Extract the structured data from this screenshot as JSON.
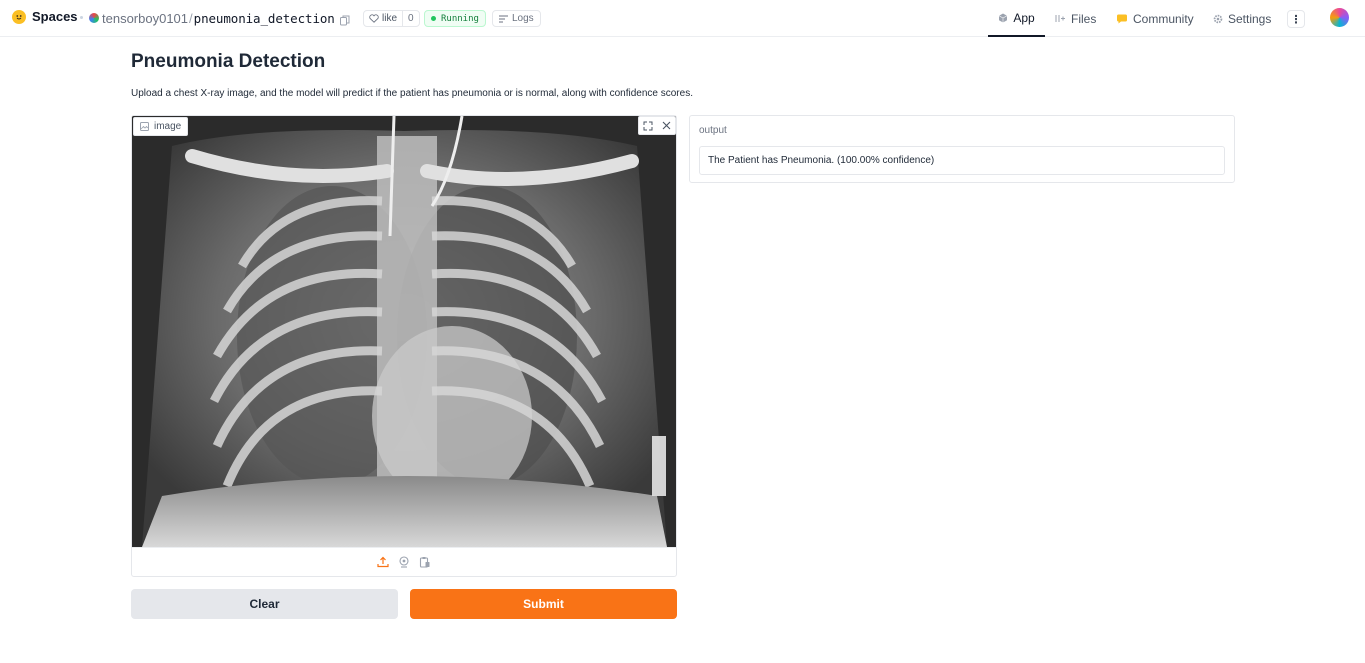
{
  "header": {
    "brand": "Spaces",
    "owner": "tensorboy0101",
    "separator": "/",
    "repo_name": "pneumonia_detection",
    "like_label": "like",
    "like_count": "0",
    "status": "Running",
    "logs_label": "Logs",
    "nav": {
      "app": "App",
      "files": "Files",
      "community": "Community",
      "settings": "Settings"
    }
  },
  "main": {
    "title": "Pneumonia Detection",
    "description": "Upload a chest X-ray image, and the model will predict if the patient has pneumonia or is normal, along with confidence scores.",
    "image_input": {
      "label": "image"
    },
    "output": {
      "label": "output",
      "value": "The Patient has Pneumonia. (100.00% confidence)"
    },
    "buttons": {
      "clear": "Clear",
      "submit": "Submit"
    }
  },
  "colors": {
    "accent": "#f97316",
    "running_green": "#22c55e",
    "clear_button": "#e5e7eb"
  }
}
